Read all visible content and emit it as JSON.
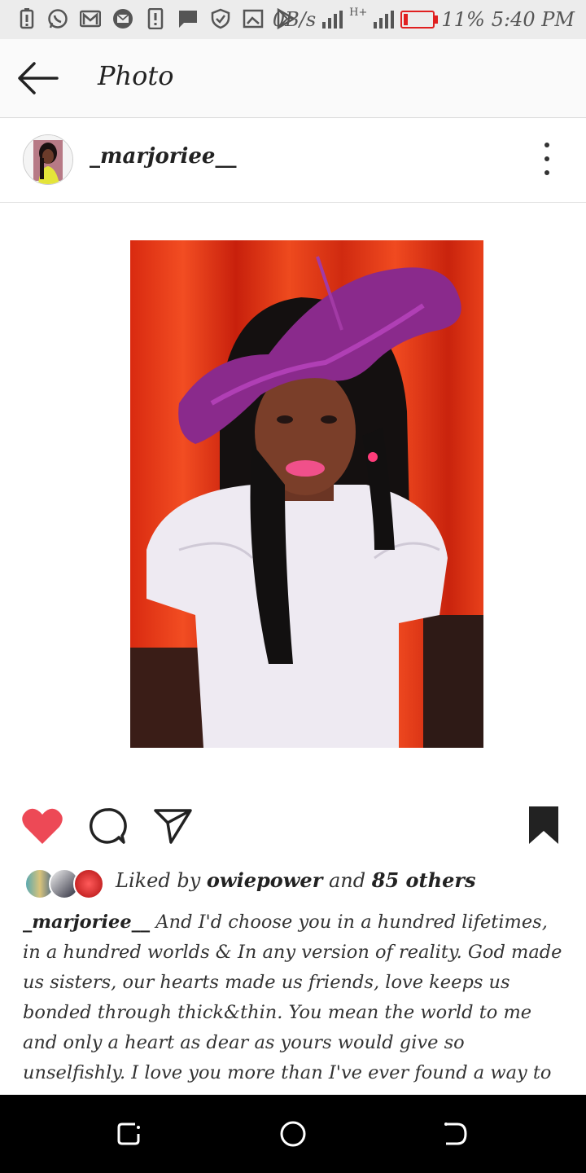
{
  "status_bar": {
    "net_speed": "0B/s",
    "network_type": "H+",
    "battery": "11%",
    "time": "5:40 PM",
    "icons": [
      "battery-alert-icon",
      "whatsapp-icon",
      "gmail-icon",
      "mail-icon",
      "alert-icon",
      "message-icon",
      "shield-icon",
      "screenshot-icon",
      "play-store-icon"
    ]
  },
  "app_bar": {
    "title": "Photo",
    "back_icon": "arrow-left-icon"
  },
  "post": {
    "username": "_marjoriee__",
    "more_icon": "more-vertical-icon",
    "liked_prefix": "Liked by",
    "liked_user": "owiepower",
    "liked_and": "and",
    "liked_others": "85 others",
    "caption_user": "_marjoriee__",
    "caption_text": "And I'd choose you in a hundred lifetimes, in a hundred worlds & In any version of reality. God made us sisters, our hearts made us friends, love keeps us bonded through thick&thin. You mean the world to me and only a heart as dear as yours would give so unselfishly. I love you more than I've ever found a way to say to you. God bless U abundantly. Forever & always babe ❤️ Love u lots ❤️🎉"
  },
  "actions": {
    "like_icon": "heart-icon",
    "comment_icon": "comment-icon",
    "share_icon": "send-icon",
    "save_icon": "bookmark-icon",
    "like_color": "#ed4956"
  },
  "nav_bar": {
    "icons": [
      "recent-apps-icon",
      "home-icon",
      "back-icon"
    ]
  }
}
